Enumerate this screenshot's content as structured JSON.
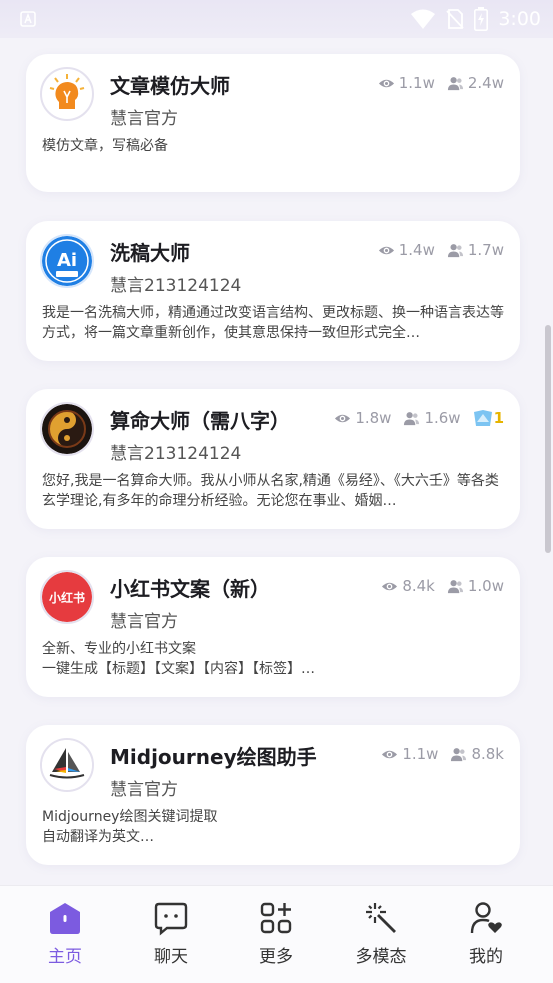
{
  "status_bar": {
    "time": "3:00"
  },
  "cards": [
    {
      "title": "文章模仿大师",
      "author": "慧言官方",
      "description": "模仿文章，写稿必备",
      "views": "1.1w",
      "users": "2.4w",
      "avatar_icon": "lightbulb-head-icon"
    },
    {
      "title": "洗稿大师",
      "author": "慧言213124124",
      "description": "我是一名洗稿大师，精通通过改变语言结构、更改标题、换一种语言表达等方式，将一篇文章重新创作，使其意思保持一致但形式完全…",
      "views": "1.4w",
      "users": "1.7w",
      "avatar_icon": "ai-writing-icon",
      "avatar_text": "Ai"
    },
    {
      "title": "算命大师（需八字）",
      "author": "慧言213124124",
      "description": "您好,我是一名算命大师。我从小师从名家,精通《易经》、《大六壬》等各类玄学理论,有多年的命理分析经验。无论您在事业、婚姻…",
      "views": "1.8w",
      "users": "1.6w",
      "badge": "1",
      "avatar_icon": "yin-yang-icon"
    },
    {
      "title": "小红书文案（新）",
      "author": "慧言官方",
      "description": "全新、专业的小红书文案\n一键生成【标题】【文案】【内容】【标签】…",
      "views": "8.4k",
      "users": "1.0w",
      "avatar_icon": "xiaohongshu-icon",
      "avatar_text": "小红书"
    },
    {
      "title": "Midjourney绘图助手",
      "author": "慧言官方",
      "description": "Midjourney绘图关键词提取\n自动翻译为英文…",
      "views": "1.1w",
      "users": "8.8k",
      "avatar_icon": "sailboat-icon"
    }
  ],
  "nav": [
    {
      "label": "主页",
      "icon": "home-icon",
      "active": true
    },
    {
      "label": "聊天",
      "icon": "chat-icon",
      "active": false
    },
    {
      "label": "更多",
      "icon": "apps-plus-icon",
      "active": false
    },
    {
      "label": "多模态",
      "icon": "magic-wand-icon",
      "active": false
    },
    {
      "label": "我的",
      "icon": "profile-heart-icon",
      "active": false
    }
  ],
  "colors": {
    "accent": "#7c5be0",
    "stat_gray": "#9b9ba6",
    "background": "#f4f3f9"
  }
}
